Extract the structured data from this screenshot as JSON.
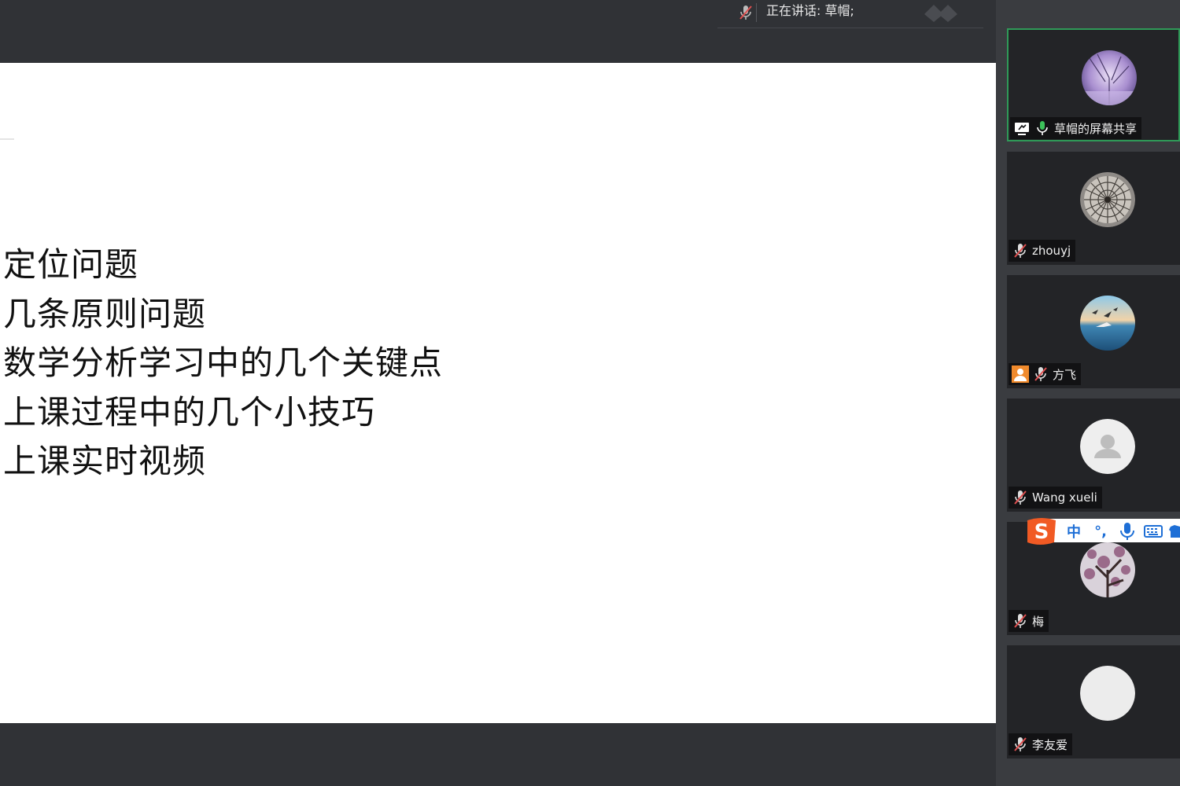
{
  "topbar": {
    "speaking_label": "正在讲话: 草帽;"
  },
  "slide": {
    "lines": [
      "定位问题",
      "几条原则问题",
      "数学分析学习中的几个关键点",
      "上课过程中的几个小技巧",
      "上课实时视频"
    ]
  },
  "participants": [
    {
      "name": "草帽的屏幕共享",
      "mic": "mic-on-icon",
      "extra_icon": "screen-share-icon",
      "avatar": "purple-branches",
      "active": true
    },
    {
      "name": "zhouyj",
      "mic": "mic-muted-icon",
      "avatar": "dome-ceiling"
    },
    {
      "name": "方飞",
      "mic": "mic-muted-icon",
      "extra_icon": "host-person-icon",
      "avatar": "seagulls-sea"
    },
    {
      "name": "Wang xueli",
      "mic": "mic-muted-icon",
      "avatar": "default-person"
    },
    {
      "name": "梅",
      "mic": "mic-muted-icon",
      "avatar": "blossom-tree"
    },
    {
      "name": "李友爱",
      "mic": "mic-muted-icon",
      "avatar": "blank-circle"
    }
  ],
  "ime_toolbar": {
    "mode_label": "中",
    "punct_label": "°,",
    "icons": [
      "sogou-logo-icon",
      "voice-mic-icon",
      "keyboard-icon",
      "shirt-skin-icon"
    ]
  },
  "colors": {
    "active_border": "#2f9a58",
    "mic_on": "#3cc25a",
    "muted": "#e05050",
    "ime_accent": "#1e6fd6",
    "sogou_orange": "#f15a24"
  }
}
